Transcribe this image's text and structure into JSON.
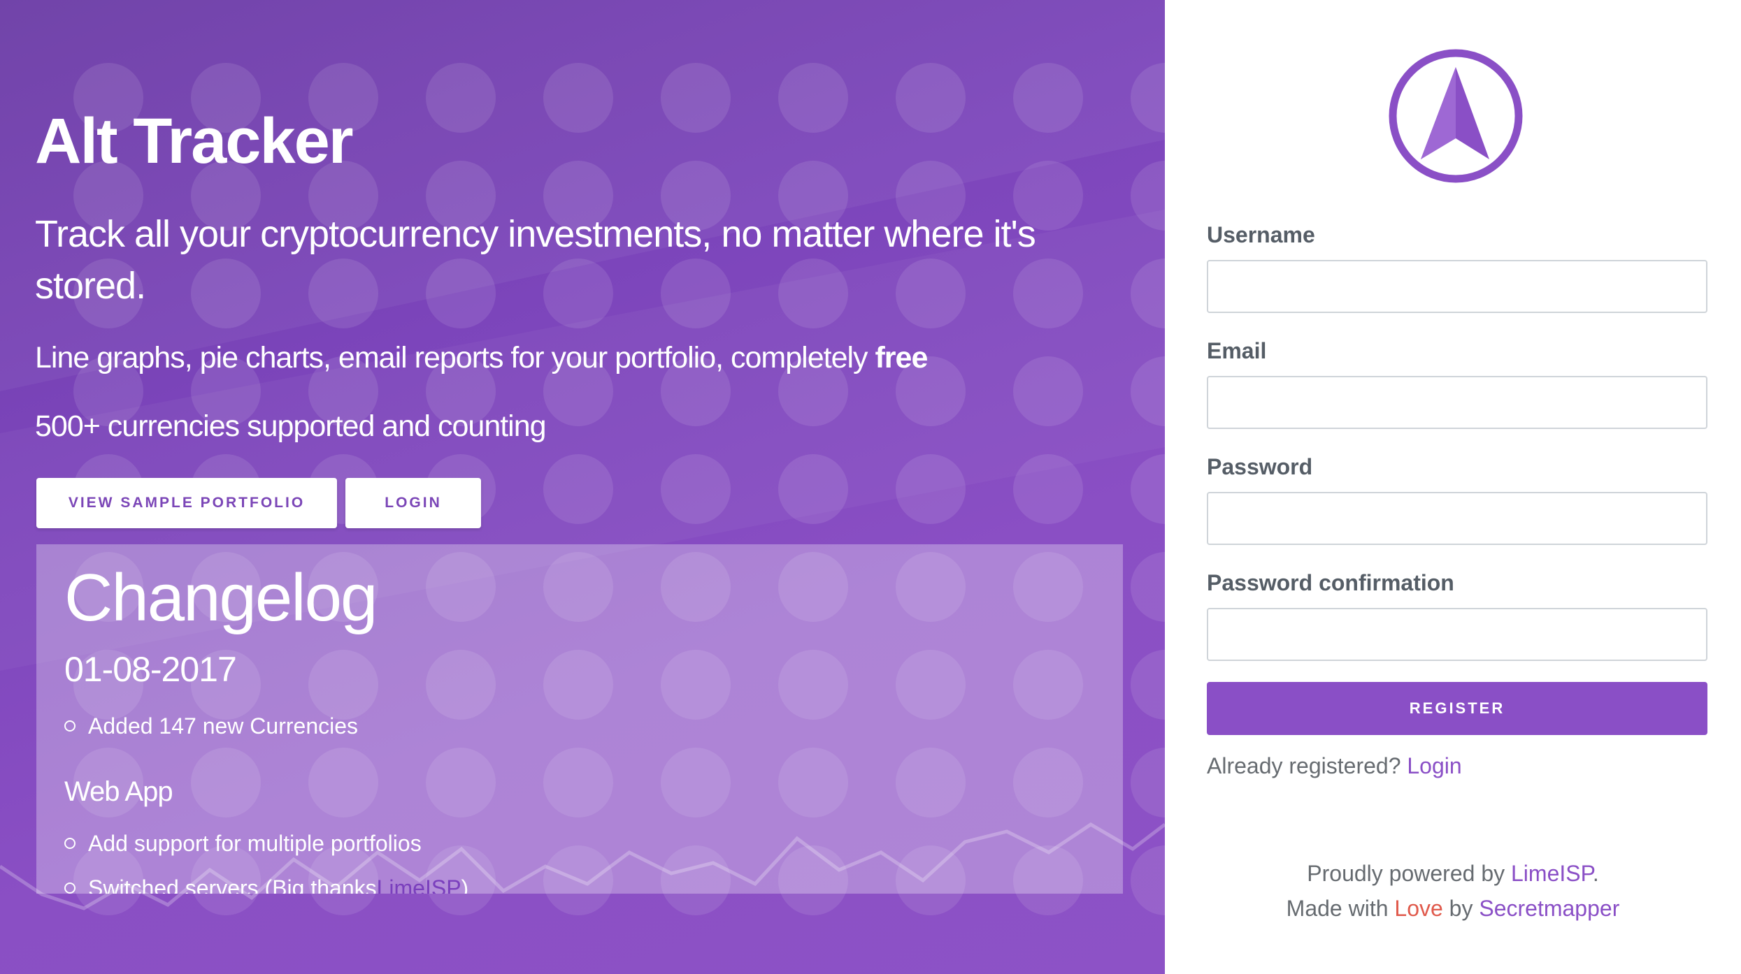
{
  "hero": {
    "brand": "Alt Tracker",
    "tagline": "Track all your cryptocurrency investments, no matter where it's stored.",
    "feature_1_text": "Line graphs, pie charts, email reports for your portfolio, completely ",
    "feature_1_emphasis": "free",
    "feature_2": "500+ currencies supported and counting",
    "sample_button": "VIEW SAMPLE PORTFOLIO",
    "login_button": "LOGIN"
  },
  "changelog": {
    "title": "Changelog",
    "date": "01-08-2017",
    "date_items": [
      "Added 147 new Currencies"
    ],
    "section": "Web App",
    "section_items": [
      "Add support for multiple portfolios"
    ],
    "partial_item_text": "Switched servers (Big thanks ",
    "partial_item_link": "LimeISP",
    "partial_item_end": ")"
  },
  "form": {
    "username_label": "Username",
    "email_label": "Email",
    "password_label": "Password",
    "password_confirmation_label": "Password confirmation",
    "username_value": "",
    "email_value": "",
    "password_value": "",
    "password_confirmation_value": "",
    "register_button": "REGISTER",
    "already_text": "Already registered?",
    "login_link": "Login"
  },
  "footer": {
    "powered_text": "Proudly powered by ",
    "powered_link": "LimeISP",
    "powered_end": ".",
    "made_text": "Made with ",
    "love": "Love",
    "by_text": " by ",
    "author": "Secretmapper"
  },
  "colors": {
    "accent": "#8a4fc6",
    "hero_start": "#6a3aa5",
    "hero_end": "#8d52c6",
    "love": "#e05a4c"
  },
  "icons": {
    "logo": "alt-tracker-logo-icon",
    "background": "cryptocurrency-coin-icons"
  }
}
